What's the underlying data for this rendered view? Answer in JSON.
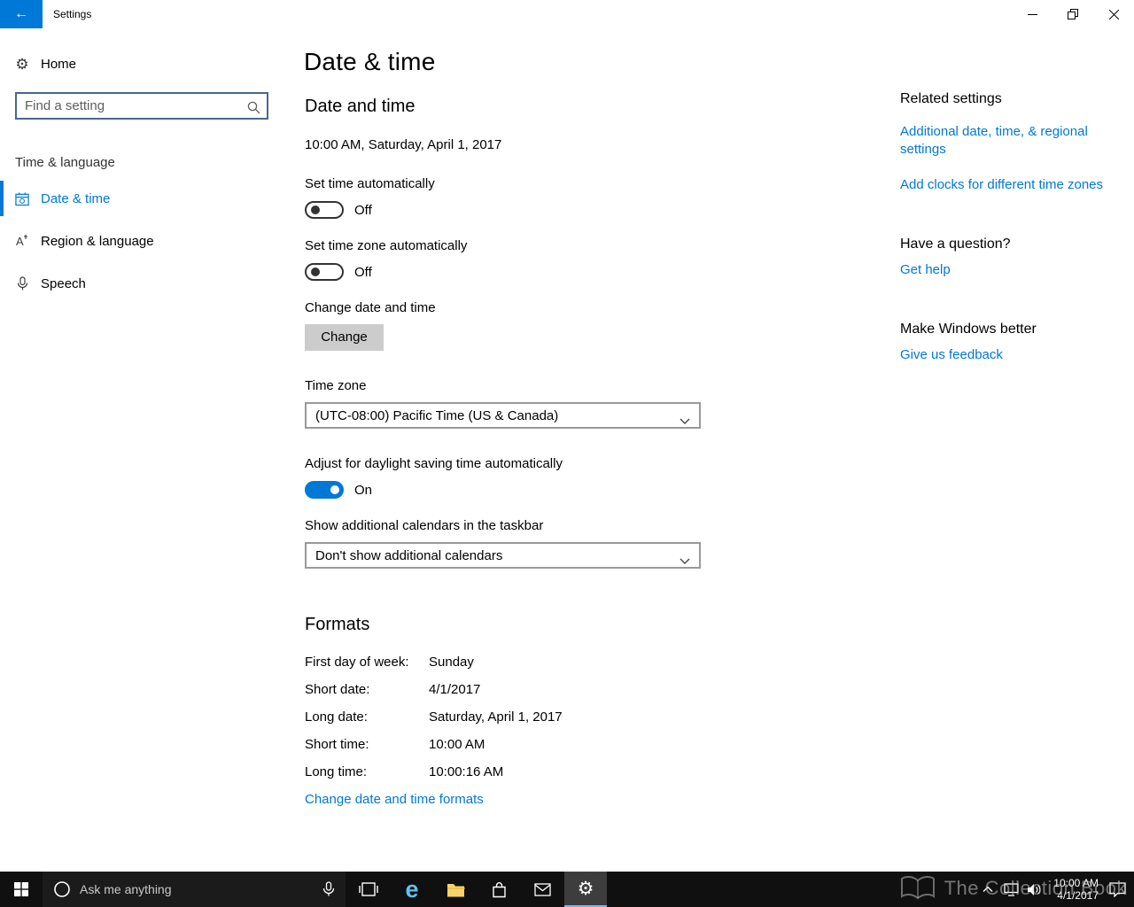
{
  "titlebar": {
    "title": "Settings"
  },
  "icons": {
    "back_arrow": "←",
    "gear": "⚙",
    "edge_logo": "e",
    "region_glyph": "A",
    "search_icon": "magnifier",
    "calendar_clock_icon": "calendar-with-clock",
    "mic_icon": "microphone",
    "window_controls": "minimize / restore / close"
  },
  "sidebar": {
    "home_label": "Home",
    "search_placeholder": "Find a setting",
    "section_label": "Time & language",
    "items": [
      {
        "label": "Date & time",
        "selected": true
      },
      {
        "label": "Region & language",
        "selected": false
      },
      {
        "label": "Speech",
        "selected": false
      }
    ]
  },
  "page": {
    "title": "Date & time",
    "datetime": {
      "heading": "Date and time",
      "current_datetime": "10:00 AM, Saturday, April 1, 2017",
      "set_time_label": "Set time automatically",
      "set_time_state": "Off",
      "set_timezone_label": "Set time zone automatically",
      "set_timezone_state": "Off",
      "change_label": "Change date and time",
      "change_button": "Change",
      "timezone_label": "Time zone",
      "timezone_value": "(UTC-08:00) Pacific Time (US & Canada)",
      "dst_label": "Adjust for daylight saving time automatically",
      "dst_state": "On",
      "calendars_label": "Show additional calendars in the taskbar",
      "calendars_value": "Don't show additional calendars"
    },
    "formats": {
      "heading": "Formats",
      "rows": [
        {
          "label": "First day of week:",
          "value": "Sunday"
        },
        {
          "label": "Short date:",
          "value": "4/1/2017"
        },
        {
          "label": "Long date:",
          "value": "Saturday, April 1, 2017"
        },
        {
          "label": "Short time:",
          "value": "10:00 AM"
        },
        {
          "label": "Long time:",
          "value": "10:00:16 AM"
        }
      ],
      "change_link": "Change date and time formats"
    }
  },
  "related": {
    "heading": "Related settings",
    "link_regional": "Additional date, time, & regional settings",
    "link_clocks": "Add clocks for different time zones",
    "question_heading": "Have a question?",
    "question_link": "Get help",
    "better_heading": "Make Windows better",
    "better_link": "Give us feedback"
  },
  "taskbar": {
    "search_placeholder": "Ask me anything",
    "clock_time": "10:00 AM",
    "clock_date": "4/1/2017"
  },
  "watermark": "The Collection Book",
  "colors": {
    "accent": "#0078d7",
    "link": "#0078d7",
    "taskbar_bg": "#101010"
  }
}
